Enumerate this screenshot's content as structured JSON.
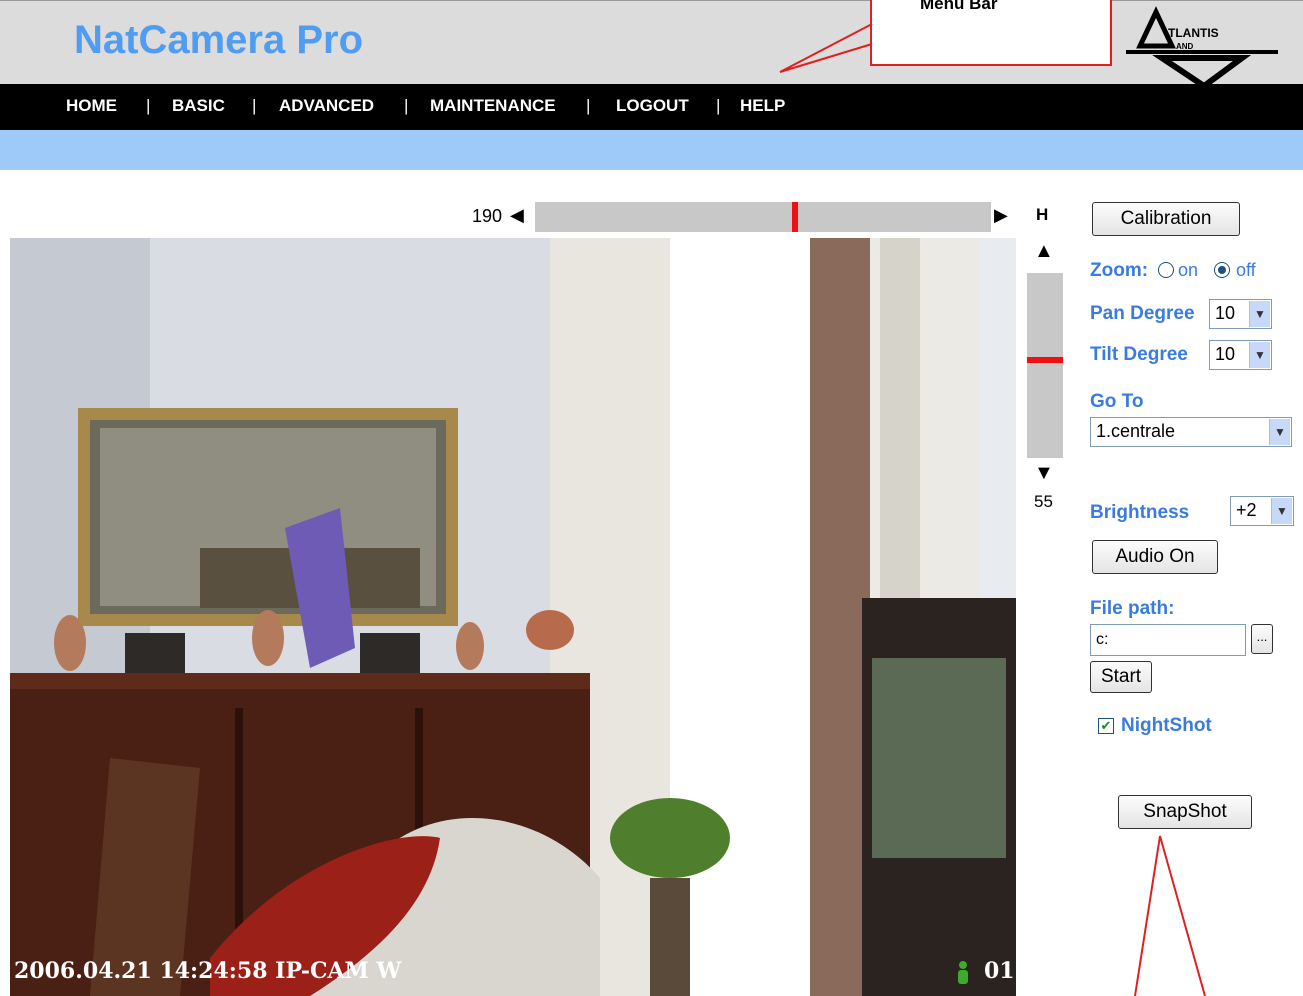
{
  "header": {
    "app_title": "NatCamera Pro",
    "logo_text": "TLANTIS",
    "logo_sub": "AND"
  },
  "callout": {
    "label": "Menu Bar"
  },
  "menu": [
    {
      "label": "HOME"
    },
    {
      "label": "BASIC"
    },
    {
      "label": "ADVANCED"
    },
    {
      "label": "MAINTENANCE"
    },
    {
      "label": "LOGOUT"
    },
    {
      "label": "HELP"
    }
  ],
  "pan": {
    "min_label": "190",
    "axis_label": "H",
    "position_fraction": 0.57
  },
  "tilt": {
    "min_label": "55",
    "position_fraction": 0.47
  },
  "camera": {
    "overlay": "2006.04.21 14:24:58 IP-CAM W",
    "channel": "01"
  },
  "panel": {
    "calibration_label": "Calibration",
    "zoom_label": "Zoom:",
    "zoom_on": "on",
    "zoom_off": "off",
    "zoom_selected": "off",
    "pan_degree_label": "Pan Degree",
    "pan_degree_value": "10",
    "tilt_degree_label": "Tilt Degree",
    "tilt_degree_value": "10",
    "goto_label": "Go To",
    "goto_value": "1.centrale",
    "brightness_label": "Brightness",
    "brightness_value": "+2",
    "audio_label": "Audio On",
    "filepath_label": "File path:",
    "filepath_value": "c:",
    "browse_label": "...",
    "start_label": "Start",
    "nightshot_label": "NightShot",
    "nightshot_checked": true,
    "snapshot_label": "SnapShot"
  },
  "colors": {
    "accent": "#3a7be0",
    "title": "#4f9cf0",
    "menubar": "#000000",
    "bluebar": "#9dcaf8",
    "marker": "#ee1111"
  }
}
